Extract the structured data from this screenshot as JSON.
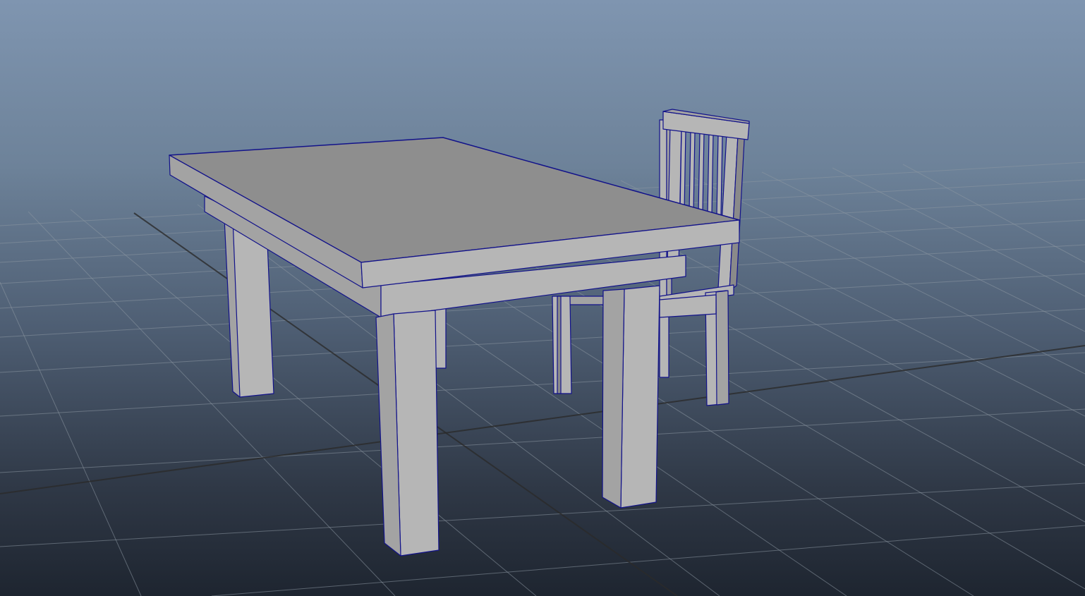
{
  "viewport": {
    "background_top": "#7f95b0",
    "background_bottom": "#1e2530",
    "grid_color": "#8d97a3",
    "wireframe_color": "#12128a",
    "mesh_color": "#b6b6b6"
  },
  "scene": {
    "objects": [
      "table-mesh",
      "chair-mesh"
    ]
  }
}
